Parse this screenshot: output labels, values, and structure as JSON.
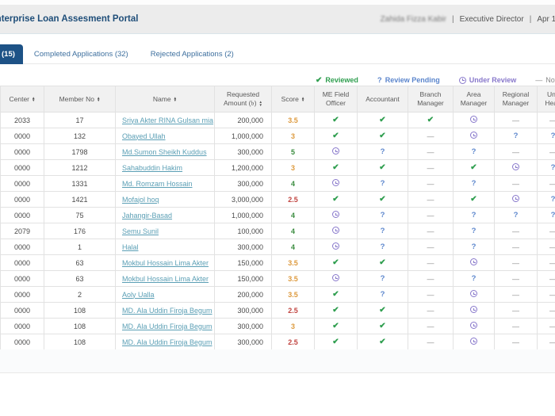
{
  "header": {
    "title": "Enterprise Loan Assesment Portal",
    "user_name": "Zahida Fizza Kabir",
    "separator": "|",
    "user_role": "Executive Director",
    "date": "Apr 1,"
  },
  "tabs": [
    {
      "label": "(15)",
      "active": true
    },
    {
      "label": "Completed Applications (32)",
      "active": false
    },
    {
      "label": "Rejected Applications (2)",
      "active": false
    }
  ],
  "legend": [
    {
      "status": "reviewed",
      "label": "Reviewed"
    },
    {
      "status": "review-pending",
      "label": "Review Pending"
    },
    {
      "status": "under-review",
      "label": "Under Review"
    },
    {
      "status": "not-reviewed",
      "label": "Not Reviewed"
    }
  ],
  "table": {
    "columns": [
      {
        "label": "Center",
        "sortable": true
      },
      {
        "label": "Member No",
        "sortable": true
      },
      {
        "label": "Name",
        "sortable": true
      },
      {
        "label": "Requested Amount (৳)",
        "sortable": true
      },
      {
        "label": "Score",
        "sortable": true
      },
      {
        "label": "ME Field Officer",
        "sortable": false
      },
      {
        "label": "Accountant",
        "sortable": false
      },
      {
        "label": "Branch Manager",
        "sortable": false
      },
      {
        "label": "Area Manager",
        "sortable": false
      },
      {
        "label": "Regional Manager",
        "sortable": false
      },
      {
        "label": "Unit Head",
        "sortable": false
      }
    ],
    "rows": [
      {
        "center": "2033",
        "member_no": "17",
        "name": "Sriya Akter RINA Gulsan mia",
        "amount": "200,000",
        "score": "3.5",
        "score_color": "orange",
        "statuses": [
          "reviewed",
          "reviewed",
          "reviewed",
          "under-review",
          "none",
          "none"
        ]
      },
      {
        "center": "0000",
        "member_no": "132",
        "name": "Obayed Ullah",
        "amount": "1,000,000",
        "score": "3",
        "score_color": "orange",
        "statuses": [
          "reviewed",
          "reviewed",
          "none",
          "under-review",
          "pending",
          "pending"
        ]
      },
      {
        "center": "0000",
        "member_no": "1798",
        "name": "Md.Sumon Sheikh Kuddus",
        "amount": "300,000",
        "score": "5",
        "score_color": "green",
        "statuses": [
          "under-review",
          "pending",
          "none",
          "pending",
          "none",
          "none"
        ]
      },
      {
        "center": "0000",
        "member_no": "1212",
        "name": "Sahabuddin Hakim",
        "amount": "1,200,000",
        "score": "3",
        "score_color": "orange",
        "statuses": [
          "reviewed",
          "reviewed",
          "none",
          "reviewed",
          "under-review",
          "pending"
        ]
      },
      {
        "center": "0000",
        "member_no": "1331",
        "name": "Md. Romzam Hossain",
        "amount": "300,000",
        "score": "4",
        "score_color": "green",
        "statuses": [
          "under-review",
          "pending",
          "none",
          "pending",
          "none",
          "none"
        ]
      },
      {
        "center": "0000",
        "member_no": "1421",
        "name": "Mofajol hoq",
        "amount": "3,000,000",
        "score": "2.5",
        "score_color": "red",
        "statuses": [
          "reviewed",
          "reviewed",
          "none",
          "reviewed",
          "under-review",
          "pending"
        ]
      },
      {
        "center": "0000",
        "member_no": "75",
        "name": "Jahangir-Basad",
        "amount": "1,000,000",
        "score": "4",
        "score_color": "green",
        "statuses": [
          "under-review",
          "pending",
          "none",
          "pending",
          "pending",
          "pending"
        ]
      },
      {
        "center": "2079",
        "member_no": "176",
        "name": "Semu Sunil",
        "amount": "100,000",
        "score": "4",
        "score_color": "green",
        "statuses": [
          "under-review",
          "pending",
          "none",
          "pending",
          "none",
          "none"
        ]
      },
      {
        "center": "0000",
        "member_no": "1",
        "name": "Halal",
        "amount": "300,000",
        "score": "4",
        "score_color": "green",
        "statuses": [
          "under-review",
          "pending",
          "none",
          "pending",
          "none",
          "none"
        ]
      },
      {
        "center": "0000",
        "member_no": "63",
        "name": "Mokbul Hossain Lima Akter",
        "amount": "150,000",
        "score": "3.5",
        "score_color": "orange",
        "statuses": [
          "reviewed",
          "reviewed",
          "none",
          "under-review",
          "none",
          "none"
        ]
      },
      {
        "center": "0000",
        "member_no": "63",
        "name": "Mokbul Hossain Lima Akter",
        "amount": "150,000",
        "score": "3.5",
        "score_color": "orange",
        "statuses": [
          "under-review",
          "pending",
          "none",
          "pending",
          "none",
          "none"
        ]
      },
      {
        "center": "0000",
        "member_no": "2",
        "name": "Aoly Ualla",
        "amount": "200,000",
        "score": "3.5",
        "score_color": "orange",
        "statuses": [
          "reviewed",
          "pending",
          "none",
          "under-review",
          "none",
          "none"
        ]
      },
      {
        "center": "0000",
        "member_no": "108",
        "name": "MD. Ala Uddin Firoja Begum",
        "amount": "300,000",
        "score": "2.5",
        "score_color": "red",
        "statuses": [
          "reviewed",
          "reviewed",
          "none",
          "under-review",
          "none",
          "none"
        ]
      },
      {
        "center": "0000",
        "member_no": "108",
        "name": "MD. Ala Uddin Firoja Begum",
        "amount": "300,000",
        "score": "3",
        "score_color": "orange",
        "statuses": [
          "reviewed",
          "reviewed",
          "none",
          "under-review",
          "none",
          "none"
        ]
      },
      {
        "center": "0000",
        "member_no": "108",
        "name": "MD. Ala Uddin Firoja Begum",
        "amount": "300,000",
        "score": "2.5",
        "score_color": "red",
        "statuses": [
          "reviewed",
          "reviewed",
          "none",
          "under-review",
          "none",
          "none"
        ]
      }
    ]
  },
  "colors": {
    "accent_blue": "#1d5286",
    "title_blue": "#1f4e79",
    "reviewed_green": "#2f9e4f",
    "pending_blue": "#5b85cc",
    "under_review_purple": "#8878cb",
    "score_orange": "#dd9a3e",
    "score_green": "#3a8c3f",
    "score_red": "#c14541",
    "link_teal": "#5b9fb5"
  }
}
